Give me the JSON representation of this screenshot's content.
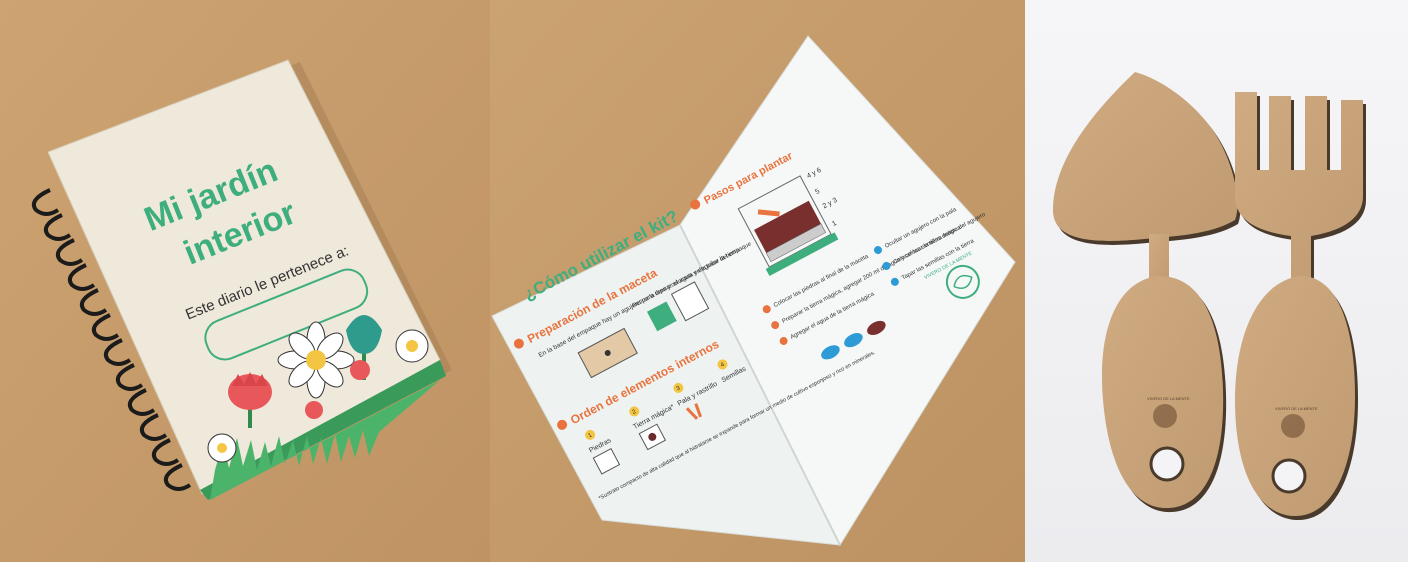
{
  "notebook": {
    "title_line1": "Mi jardín",
    "title_line2": "interior",
    "owner_label": "Este diario le pertenece a:"
  },
  "leaflet": {
    "heading": "¿Cómo utilizar el kit?",
    "steps_heading": "Pasos para plantar",
    "section1_title": "Preparación de la maceta",
    "section1_text": "En la base del empaque hay un agujero para drenar el agua y degollar la tierra",
    "section1_text_b": "Retirar la tapa y colocarla en la base del empaque",
    "section2_title": "Orden de elementos internos",
    "items": [
      "Piedras",
      "Tierra mágica*",
      "Pala y rastrillo",
      "Semillas"
    ],
    "item_numbers": [
      "1",
      "2",
      "3",
      "4"
    ],
    "footnote": "*Sustrato compacto de alta calidad que al hidratarse se expande para formar un medio de cultivo esponjoso y rico en minerales.",
    "layers": [
      "4 y 6",
      "5",
      "2 y 3",
      "1"
    ],
    "steps": [
      "Colocar las piedras al final de la maceta",
      "Preparar la tierra mágica, agregar 200 ml de agua y colocar la tierra mágica",
      "Agregar el agua de la tierra mágica",
      "Ocultar un agujero con la pala",
      "Colocar las semillas dentro del agujero",
      "Tapar las semillas con la tierra"
    ],
    "brand": "VIVERO DE LA MENTE"
  },
  "tools": {
    "brand": "VIVERO DE LA MENTE"
  },
  "colors": {
    "cardboard": "#c79c6c",
    "paper": "#efe9dc",
    "green": "#3fae7e",
    "orange": "#e9733f",
    "wood": "#c9a27a",
    "wood_edge": "#4a3a2c"
  }
}
